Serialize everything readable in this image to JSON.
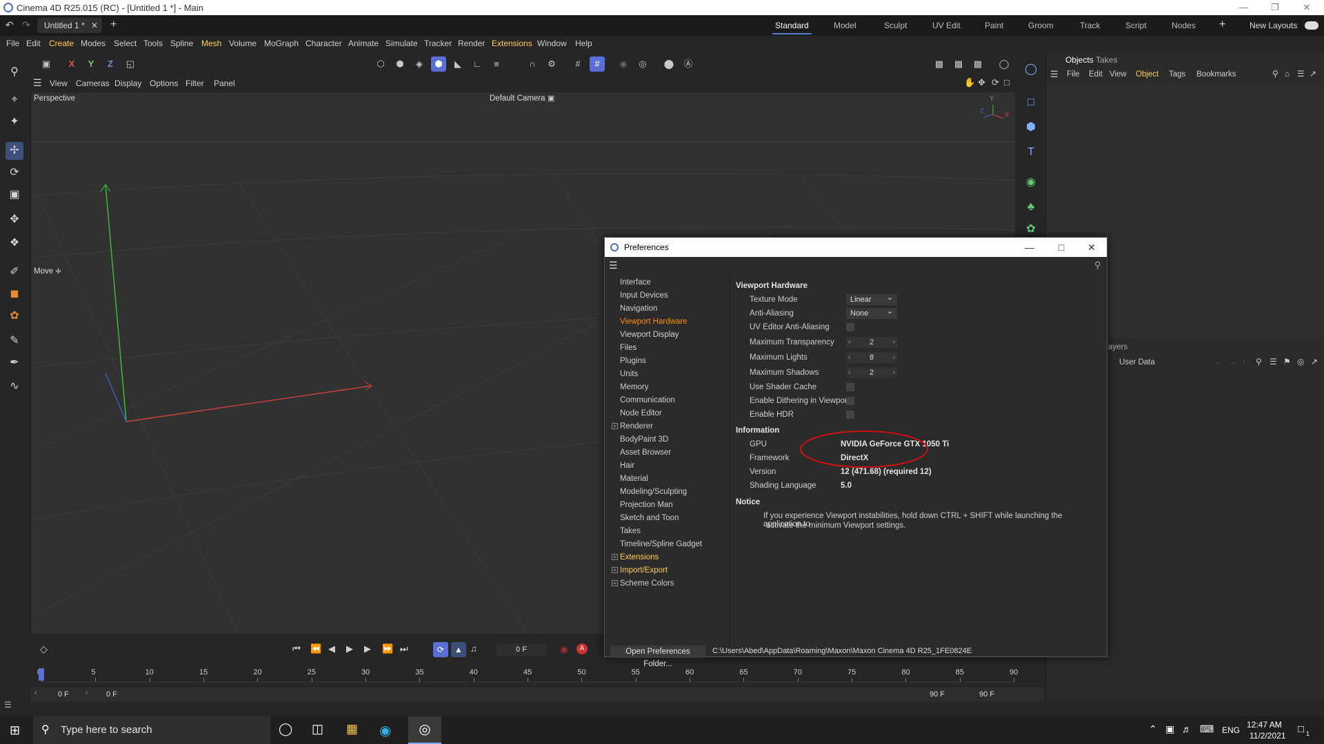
{
  "window": {
    "title": "Cinema 4D R25.015 (RC) - [Untitled 1 *] - Main"
  },
  "tabs": {
    "doc_tab": "Untitled 1 *",
    "add": "+"
  },
  "layouts": [
    "Standard",
    "Model",
    "Sculpt",
    "UV Edit",
    "Paint",
    "Groom",
    "Track",
    "Script",
    "Nodes"
  ],
  "layout_add": "+",
  "new_layouts": "New Layouts",
  "menu": [
    "File",
    "Edit",
    "Create",
    "Modes",
    "Select",
    "Tools",
    "Spline",
    "Mesh",
    "Volume",
    "MoGraph",
    "Character",
    "Animate",
    "Simulate",
    "Tracker",
    "Render",
    "Extensions",
    "Window",
    "Help"
  ],
  "axes_toolbar": {
    "x": "X",
    "y": "Y",
    "z": "Z"
  },
  "viewport": {
    "menu": [
      "View",
      "Cameras",
      "Display",
      "Options",
      "Filter",
      "Panel"
    ],
    "label": "Perspective",
    "camera": "Default Camera",
    "move_label": "Move",
    "axis_y": "Y",
    "axis_z": "Z",
    "axis_x": "X"
  },
  "objects_panel": {
    "tabs": [
      "Objects",
      "Takes"
    ],
    "menu": [
      "File",
      "Edit",
      "View",
      "Object",
      "Tags",
      "Bookmarks"
    ],
    "layers_label": "ayers",
    "user_data": "User Data"
  },
  "preferences": {
    "title": "Preferences",
    "tree": [
      {
        "label": "Interface",
        "plus": false,
        "selected": false,
        "ext": false
      },
      {
        "label": "Input Devices",
        "plus": false,
        "selected": false,
        "ext": false
      },
      {
        "label": "Navigation",
        "plus": false,
        "selected": false,
        "ext": false
      },
      {
        "label": "Viewport Hardware",
        "plus": false,
        "selected": true,
        "ext": false
      },
      {
        "label": "Viewport Display",
        "plus": false,
        "selected": false,
        "ext": false
      },
      {
        "label": "Files",
        "plus": false,
        "selected": false,
        "ext": false
      },
      {
        "label": "Plugins",
        "plus": false,
        "selected": false,
        "ext": false
      },
      {
        "label": "Units",
        "plus": false,
        "selected": false,
        "ext": false
      },
      {
        "label": "Memory",
        "plus": false,
        "selected": false,
        "ext": false
      },
      {
        "label": "Communication",
        "plus": false,
        "selected": false,
        "ext": false
      },
      {
        "label": "Node Editor",
        "plus": false,
        "selected": false,
        "ext": false
      },
      {
        "label": "Renderer",
        "plus": true,
        "selected": false,
        "ext": false
      },
      {
        "label": "BodyPaint 3D",
        "plus": false,
        "selected": false,
        "ext": false
      },
      {
        "label": "Asset Browser",
        "plus": false,
        "selected": false,
        "ext": false
      },
      {
        "label": "Hair",
        "plus": false,
        "selected": false,
        "ext": false
      },
      {
        "label": "Material",
        "plus": false,
        "selected": false,
        "ext": false
      },
      {
        "label": "Modeling/Sculpting",
        "plus": false,
        "selected": false,
        "ext": false
      },
      {
        "label": "Projection Man",
        "plus": false,
        "selected": false,
        "ext": false
      },
      {
        "label": "Sketch and Toon",
        "plus": false,
        "selected": false,
        "ext": false
      },
      {
        "label": "Takes",
        "plus": false,
        "selected": false,
        "ext": false
      },
      {
        "label": "Timeline/Spline Gadget",
        "plus": false,
        "selected": false,
        "ext": false
      },
      {
        "label": "Extensions",
        "plus": true,
        "selected": false,
        "ext": true
      },
      {
        "label": "Import/Export",
        "plus": true,
        "selected": false,
        "ext": true
      },
      {
        "label": "Scheme Colors",
        "plus": true,
        "selected": false,
        "ext": false
      }
    ],
    "section_viewport": "Viewport Hardware",
    "texture_mode_label": "Texture Mode",
    "texture_mode_value": "Linear",
    "anti_aliasing_label": "Anti-Aliasing",
    "anti_aliasing_value": "None",
    "uv_aa_label": "UV Editor Anti-Aliasing",
    "max_transparency_label": "Maximum Transparency",
    "max_transparency_value": "2",
    "max_lights_label": "Maximum Lights",
    "max_lights_value": "8",
    "max_shadows_label": "Maximum Shadows",
    "max_shadows_value": "2",
    "shader_cache_label": "Use Shader Cache",
    "dithering_label": "Enable Dithering in Viewport",
    "hdr_label": "Enable HDR",
    "section_info": "Information",
    "gpu_label": "GPU",
    "gpu_value": "NVIDIA GeForce GTX 1050 Ti",
    "framework_label": "Framework",
    "framework_value": "DirectX",
    "version_label": "Version",
    "version_value": "12 (471.68) (required 12)",
    "shading_label": "Shading Language",
    "shading_value": "5.0",
    "section_notice": "Notice",
    "notice_line1": "If you experience Viewport instabilities, hold down CTRL + SHIFT while launching the application to",
    "notice_line2": "activate the minimum Viewport settings.",
    "open_folder_button": "Open Preferences Folder...",
    "folder_path": "C:\\Users\\Abed\\AppData\\Roaming\\Maxon\\Maxon Cinema 4D R25_1FE0824E"
  },
  "timeline": {
    "ticks": [
      "0",
      "5",
      "10",
      "15",
      "20",
      "25",
      "30",
      "35",
      "40",
      "45",
      "50",
      "55",
      "60",
      "65",
      "70",
      "75",
      "80",
      "85",
      "90"
    ],
    "current_frame": "0 F",
    "start_frame": "0 F",
    "start_frame2": "0 F",
    "end_frame": "90 F",
    "end_frame2": "90 F"
  },
  "taskbar": {
    "search_placeholder": "Type here to search",
    "lang": "ENG",
    "time": "12:47 AM",
    "date": "11/2/2021",
    "notif": "1"
  },
  "colors": {
    "accent": "#5a7fd6",
    "selected_pref": "#ff8c00",
    "ext_pref": "#ffd24d",
    "annotation": "#d01010"
  }
}
